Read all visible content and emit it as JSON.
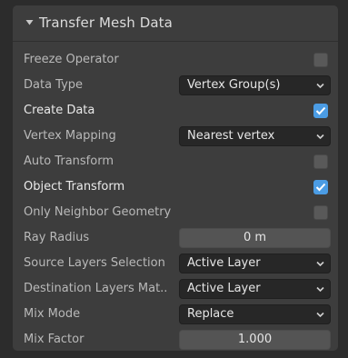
{
  "panel": {
    "title": "Transfer Mesh Data",
    "collapse_icon": "triangle-down-icon"
  },
  "rows": {
    "freeze_operator": {
      "label": "Freeze Operator",
      "checked": false
    },
    "data_type": {
      "label": "Data Type",
      "value": "Vertex Group(s)"
    },
    "create_data": {
      "label": "Create Data",
      "checked": true
    },
    "vertex_mapping": {
      "label": "Vertex Mapping",
      "value": "Nearest vertex"
    },
    "auto_transform": {
      "label": "Auto Transform",
      "checked": false
    },
    "object_transform": {
      "label": "Object Transform",
      "checked": true
    },
    "only_neighbor_geometry": {
      "label": "Only Neighbor Geometry",
      "checked": false
    },
    "ray_radius": {
      "label": "Ray Radius",
      "value": "0 m"
    },
    "source_layers_selection": {
      "label": "Source Layers Selection",
      "value": "Active Layer"
    },
    "destination_layers_mat": {
      "label": "Destination Layers Mat..",
      "value": "Active Layer"
    },
    "mix_mode": {
      "label": "Mix Mode",
      "value": "Replace"
    },
    "mix_factor": {
      "label": "Mix Factor",
      "value": "1.000"
    }
  },
  "colors": {
    "background": "#2c2c2c",
    "panel": "#3d3d3d",
    "dropdown": "#272727",
    "numfield": "#545454",
    "checkbox_off": "#595959",
    "checkbox_on": "#4b9ce4"
  }
}
